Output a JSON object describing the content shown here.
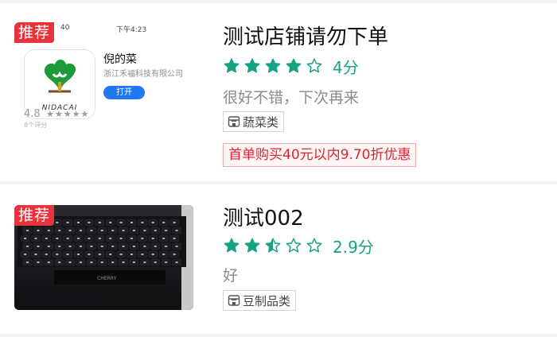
{
  "colors": {
    "accent_green": "#16a383",
    "badge_red": "#e8323c",
    "promo_red": "#e0232d"
  },
  "shops": [
    {
      "badge": "推荐",
      "name": "测试店铺请勿下单",
      "rating": 4,
      "rating_label": "4分",
      "review": "很好不错，下次再来",
      "category": "蔬菜类",
      "category_icon": "shop-icon",
      "promotion": "首单购买40元以内9.70折优惠",
      "thumbnail": {
        "status_left": "40",
        "status_center": "下午4:23",
        "app_name": "倪的菜",
        "company": "浙江禾福科技有限公司",
        "open_label": "打开",
        "logo_text": "NIDACAI",
        "rating": "4.8",
        "stars": "★★★★★",
        "rating_count": "8个评分"
      }
    },
    {
      "badge": "推荐",
      "name": "测试002",
      "rating": 2.5,
      "rating_label": "2.9分",
      "review": "好",
      "category": "豆制品类",
      "category_icon": "shop-icon",
      "thumbnail": {
        "brand": "CHERRY"
      }
    }
  ]
}
